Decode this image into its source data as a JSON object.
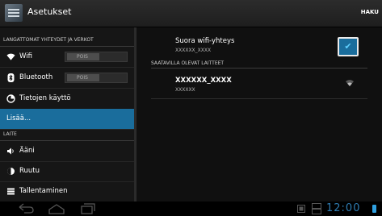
{
  "app": {
    "title": "Asetukset",
    "search_label": "HAKU",
    "icon": "settings-icon"
  },
  "sidebar": {
    "section_wireless": "LANGATTOMAT YHTEYDET JA VERKOT",
    "section_device": "LAITE",
    "items": [
      {
        "label": "Wifi",
        "icon": "wifi-icon",
        "toggle": "POIS"
      },
      {
        "label": "Bluetooth",
        "icon": "bluetooth-icon",
        "toggle": "POIS"
      },
      {
        "label": "Tietojen käyttö",
        "icon": "data-usage-icon"
      },
      {
        "label": "Lisää...",
        "selected": true
      },
      {
        "label": "Ääni",
        "icon": "sound-icon"
      },
      {
        "label": "Ruutu",
        "icon": "display-icon"
      },
      {
        "label": "Tallentaminen",
        "icon": "storage-icon"
      }
    ]
  },
  "main": {
    "direct": {
      "title": "Suora wifi-yhteys",
      "subtitle": "XXXXXX_XXXX",
      "checked": true
    },
    "available_header": "SAATAVILLA OLEVAT LAITTEET",
    "devices": [
      {
        "name": "XXXXXX_XXXX",
        "subtitle": "XXXXXX",
        "icon": "wifi-signal-icon"
      }
    ]
  },
  "statusbar": {
    "time": "12:00"
  },
  "colors": {
    "accent": "#1a6d9c",
    "clock": "#2e7bb0"
  }
}
